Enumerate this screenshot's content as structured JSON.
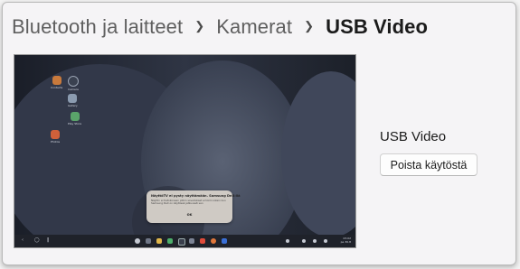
{
  "breadcrumb": {
    "items": [
      "Bluetooth ja laitteet",
      "Kamerat"
    ],
    "current": "USB Video"
  },
  "preview": {
    "desktop_icons": [
      {
        "label": "Contacts",
        "color": "#c97a3c"
      },
      {
        "label": "Camera",
        "color": "#3a4150"
      },
      {
        "label": "Gallery",
        "color": "#8b9bb0"
      },
      {
        "label": "Play Store",
        "color": "#5aa36a"
      },
      {
        "label": "Photos",
        "color": "#d0603a"
      }
    ],
    "dialog": {
      "title": "NäyttöTV ei pysty näyttämään. Samsung DeX:llä",
      "body": "Näytön ei tietokoneen jotkin sovellukset ei toimi oikein kun Samsung DeX on käytössä jatkuvasti sen",
      "ok": "OK"
    },
    "taskbar": {
      "clock_time": "23.02",
      "clock_date": "pe 30.8"
    }
  },
  "device": {
    "name": "USB Video",
    "disable_label": "Poista käytöstä"
  }
}
